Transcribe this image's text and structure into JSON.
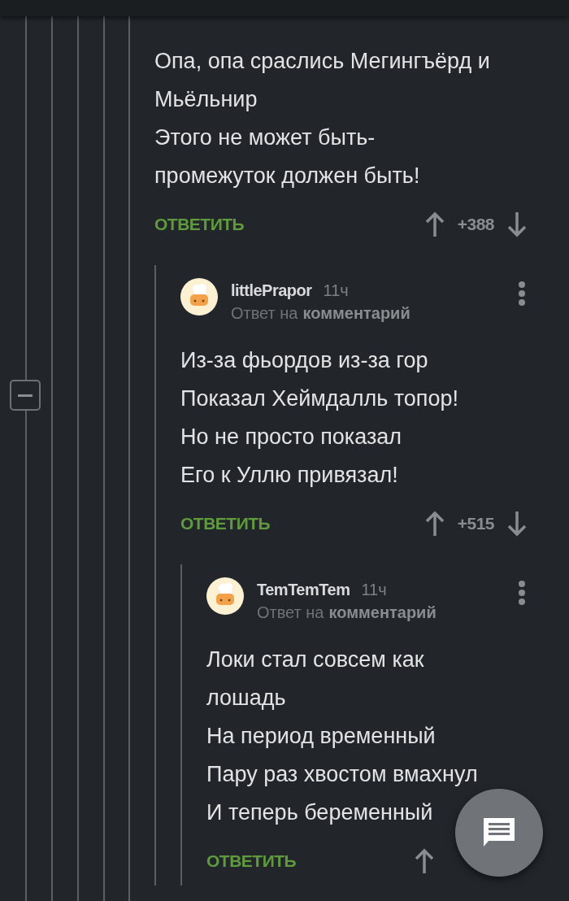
{
  "comment": {
    "lines": [
      "Опа, опа сраслись Мегингъёрд и",
      "Мьёльнир",
      "Этого не может быть-",
      "промежуток должен быть!"
    ],
    "reply_label": "ОТВЕТИТЬ",
    "rating": "+388",
    "children": [
      {
        "author": "littlePrapor",
        "time": "11ч",
        "reply_prefix": "Ответ на",
        "reply_target": "комментарий",
        "lines": [
          "Из-за фьордов из-за гор",
          "Показал Хеймдалль топор!",
          "Но не просто показал",
          "Его к Уллю привязал!"
        ],
        "reply_label": "ОТВЕТИТЬ",
        "rating": "+515",
        "children": [
          {
            "author": "TemTemTem",
            "time": "11ч",
            "reply_prefix": "Ответ на",
            "reply_target": "комментарий",
            "lines": [
              "Локи стал совсем как",
              "лошадь",
              "На период временный",
              "Пару раз хвостом вмахнул",
              "И теперь беременный"
            ],
            "reply_label": "ОТВЕТИТЬ"
          }
        ]
      }
    ]
  }
}
